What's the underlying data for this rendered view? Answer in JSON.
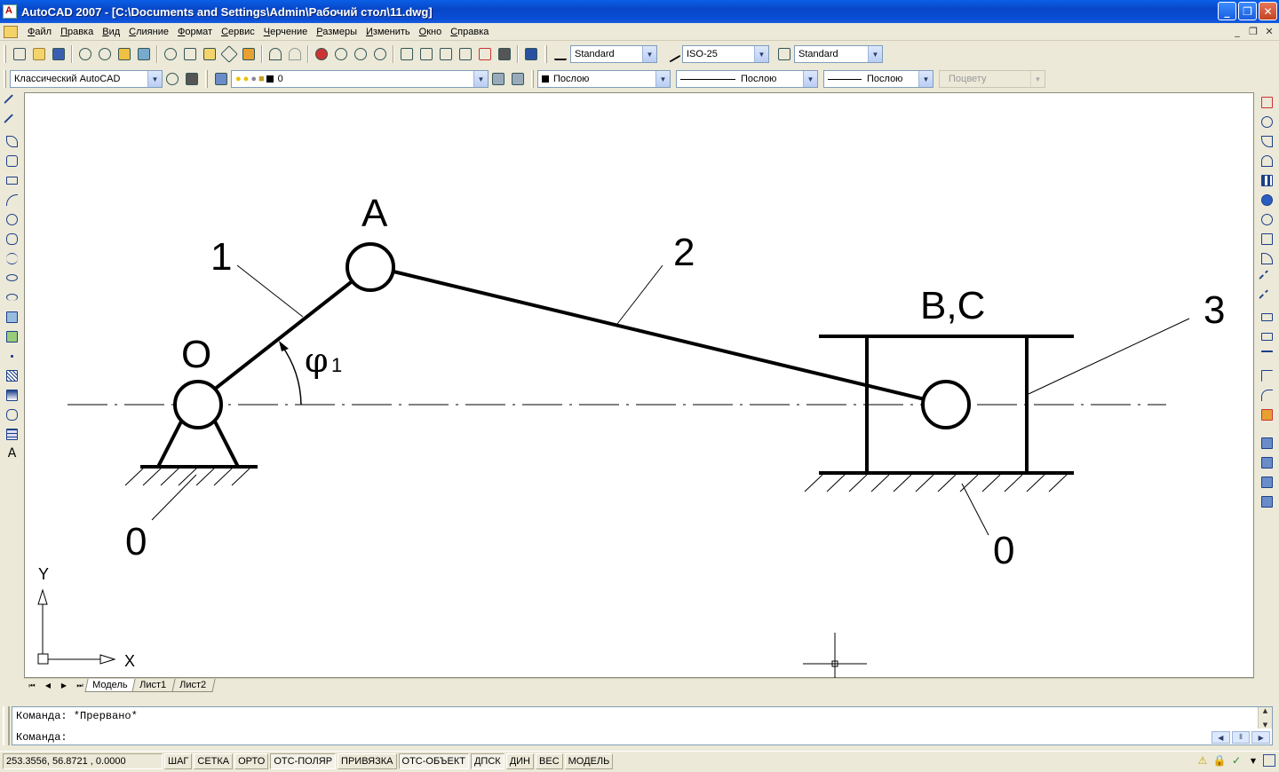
{
  "window": {
    "title": "AutoCAD 2007 - [C:\\Documents and Settings\\Admin\\Рабочий стол\\11.dwg]",
    "controls": {
      "minimize": "_",
      "maximize": "❐",
      "close": "✕"
    }
  },
  "menu": {
    "items": [
      "Файл",
      "Правка",
      "Вид",
      "Слияние",
      "Формат",
      "Сервис",
      "Черчение",
      "Размеры",
      "Изменить",
      "Окно",
      "Справка"
    ],
    "doc_controls": {
      "minimize": "_",
      "restore": "❐",
      "close": "✕"
    }
  },
  "toolbar": {
    "text_style": "Standard",
    "dim_style": "ISO-25",
    "table_style": "Standard",
    "workspace": "Классический AutoCAD",
    "layer": "0",
    "color": "Послою",
    "linetype": "Послою",
    "lineweight": "Послою",
    "plot_style": "Поцвету"
  },
  "drawing": {
    "labels": {
      "A": "A",
      "link1": "1",
      "link2": "2",
      "link3": "3",
      "O": "O",
      "phi": "φ",
      "phi_sub": "1",
      "BC": "B,C",
      "ground_left": "0",
      "ground_right": "0"
    },
    "ucs": {
      "x": "X",
      "y": "Y"
    },
    "colors": {
      "line": "#000000",
      "background": "#ffffff"
    }
  },
  "tabs": {
    "nav": [
      "⏮",
      "◀",
      "▶",
      "⏭"
    ],
    "items": [
      "Модель",
      "Лист1",
      "Лист2"
    ],
    "active": "Модель"
  },
  "command": {
    "line1": "Команда: *Прервано*",
    "line2": "Команда:"
  },
  "status": {
    "coords": "253.3556, 56.8721 , 0.0000",
    "buttons": [
      "ШАГ",
      "СЕТКА",
      "ОРТО",
      "ОТС-ПОЛЯР",
      "ПРИВЯЗКА",
      "ОТС-ОБЪЕКТ",
      "ДПСК",
      "ДИН",
      "ВЕС",
      "МОДЕЛЬ"
    ],
    "active_buttons": [
      "ОТС-ПОЛЯР",
      "ОТС-ОБЪЕКТ",
      "ДПСК"
    ]
  }
}
